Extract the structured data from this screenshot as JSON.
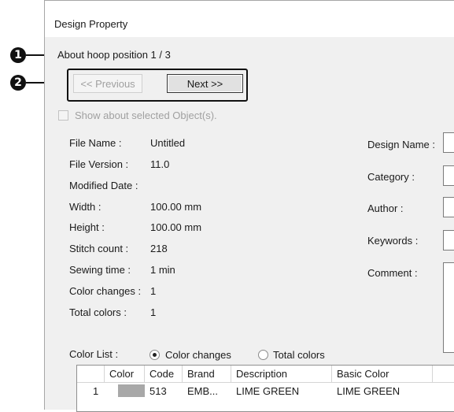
{
  "callouts": [
    "1",
    "2"
  ],
  "dialog": {
    "title": "Design Property",
    "hoop_position": "About hoop position 1 / 3",
    "previous_label": "<< Previous",
    "next_label": "Next >>",
    "show_selected_label": "Show about selected Object(s)."
  },
  "properties": [
    {
      "label": "File Name :",
      "value": "Untitled"
    },
    {
      "label": "File Version :",
      "value": "11.0"
    },
    {
      "label": "Modified Date :",
      "value": ""
    },
    {
      "label": "Width :",
      "value": "100.00 mm"
    },
    {
      "label": "Height :",
      "value": "100.00 mm"
    },
    {
      "label": "Stitch count :",
      "value": "218"
    },
    {
      "label": "Sewing time :",
      "value": "1 min"
    },
    {
      "label": "Color changes :",
      "value": "1"
    },
    {
      "label": "Total colors :",
      "value": "1"
    }
  ],
  "right_fields": {
    "design_name": "Design Name :",
    "category": "Category :",
    "author": "Author :",
    "keywords": "Keywords :",
    "comment": "Comment :"
  },
  "color_list": {
    "label": "Color List :",
    "option_changes": "Color changes",
    "option_total": "Total colors",
    "selected": "Color changes"
  },
  "table": {
    "columns": [
      "",
      "Color",
      "Code",
      "Brand",
      "Description",
      "Basic Color"
    ],
    "rows": [
      {
        "index": "1",
        "color_hex": "#a8a8a8",
        "code": "513",
        "brand": "EMB...",
        "description": "LIME GREEN",
        "basic_color": "LIME GREEN"
      }
    ]
  }
}
